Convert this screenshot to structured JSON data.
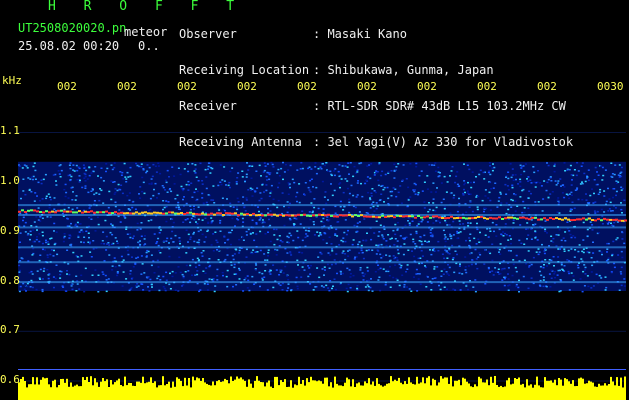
{
  "header": {
    "brand": "H R O F F T",
    "file_name": "UT2508020020.pn",
    "meteor_label": "meteor",
    "timestamp": "25.08.02 00:20",
    "count": "0..",
    "fields": [
      {
        "label": "Observer",
        "value": ": Masaki Kano"
      },
      {
        "label": "Receiving Location",
        "value": ": Shibukawa, Gunma, Japan"
      },
      {
        "label": "Receiver",
        "value": ": RTL-SDR SDR# 43dB L15 103.2MHz CW"
      },
      {
        "label": "Receiving Antenna",
        "value": ": 3el Yagi(V) Az 330 for Vladivostok"
      }
    ]
  },
  "axis": {
    "unit": "kHz",
    "time_ticks": [
      "002",
      "002",
      "002",
      "002",
      "002",
      "002",
      "002",
      "002",
      "002",
      "0030"
    ],
    "freq_ticks": [
      {
        "label": "1.1",
        "value": 1.1
      },
      {
        "label": "1.0",
        "value": 1.0
      },
      {
        "label": "0.9",
        "value": 0.9
      },
      {
        "label": "0.8",
        "value": 0.8
      },
      {
        "label": "0.7",
        "value": 0.7
      },
      {
        "label": "0.6",
        "value": 0.6
      }
    ]
  },
  "colors": {
    "text_green": "#3cff3c",
    "text_yellow": "#ffff55",
    "background": "#000000",
    "noise_blue": "#1450ff",
    "signal_red": "#ff3030",
    "level_yellow": "#ffff00"
  }
}
